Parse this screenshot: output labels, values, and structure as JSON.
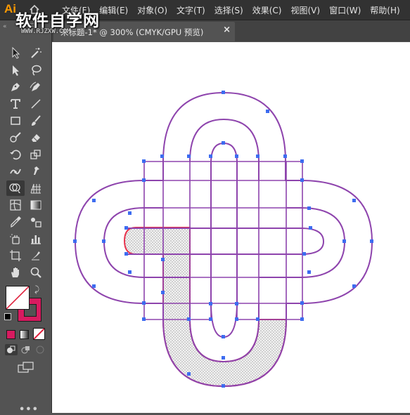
{
  "app": {
    "logo": "Ai",
    "accent_color": "#ff9a00"
  },
  "watermark": {
    "text": "软件自学网",
    "url": "WWW.RJZXW.COM"
  },
  "menu": {
    "items": [
      "文件(F)",
      "编辑(E)",
      "对象(O)",
      "文字(T)",
      "选择(S)",
      "效果(C)",
      "视图(V)",
      "窗口(W)",
      "帮助(H)"
    ]
  },
  "document_tab": {
    "title": "未标题-1* @ 300% (CMYK/GPU 预览)",
    "close_glyph": "×"
  },
  "toolbar": {
    "more_label": "•••",
    "tools": [
      "selection-tool",
      "direct-selection-tool",
      "magic-wand-tool",
      "lasso-tool",
      "pen-tool",
      "curvature-tool",
      "type-tool",
      "line-segment-tool",
      "rectangle-tool",
      "paintbrush-tool",
      "shaper-tool",
      "eraser-tool",
      "rotate-tool",
      "scale-tool",
      "width-tool",
      "puppet-warp-tool",
      "shape-builder-tool",
      "perspective-grid-tool",
      "mesh-tool",
      "gradient-tool",
      "eyedropper-tool",
      "blend-tool",
      "symbol-sprayer-tool",
      "column-graph-tool",
      "artboard-tool",
      "slice-tool",
      "hand-tool",
      "zoom-tool"
    ],
    "active_tool": "shape-builder-tool",
    "fill_color": "#ffffff",
    "stroke_color": "#d81b60",
    "swatch_colors": [
      "#d81b60",
      "gradient",
      "none"
    ]
  },
  "colors": {
    "canvas_bg": "#ffffff",
    "path_stroke": "#8e44ad",
    "selected_stroke": "#e8344e",
    "anchor_color": "#3d6cf0",
    "hatch_color": "#7a7a7a"
  }
}
